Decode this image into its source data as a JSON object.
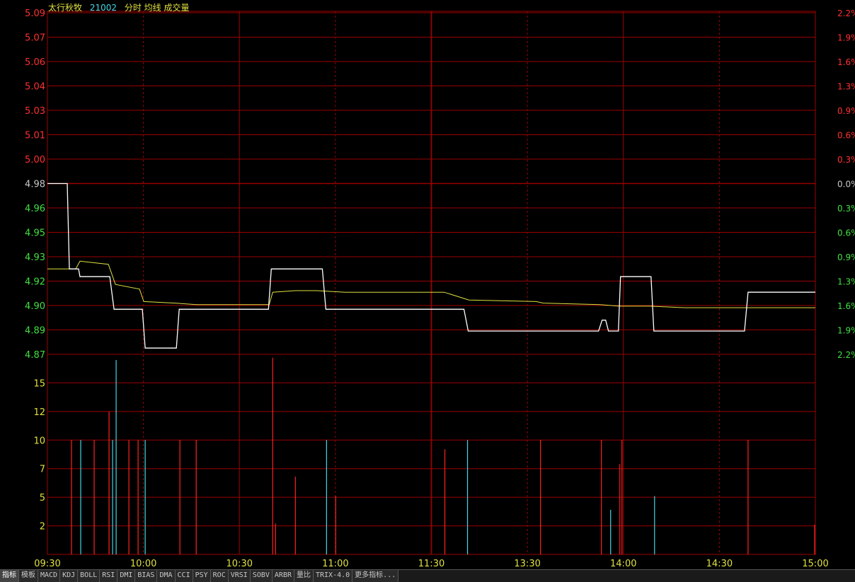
{
  "header": {
    "name": "太行秋牧",
    "code": "21002",
    "mode": "分时 均线 成交量"
  },
  "chart_data": {
    "type": "line",
    "x_ticks": [
      "09:30",
      "10:00",
      "10:30",
      "11:00",
      "11:30",
      "13:30",
      "14:00",
      "14:30",
      "15:00"
    ],
    "price_axis": {
      "ylim": [
        4.87,
        5.09
      ],
      "prev_close": 4.98,
      "ticks_up": [
        "5.09",
        "5.07",
        "5.06",
        "5.04",
        "5.03",
        "5.01",
        "5.00"
      ],
      "tick_mid": "4.98",
      "ticks_down": [
        "4.96",
        "4.95",
        "4.93",
        "4.92",
        "4.90",
        "4.89",
        "4.87"
      ],
      "pct_up": [
        "2.2%",
        "1.9%",
        "1.6%",
        "1.3%",
        "0.9%",
        "0.6%",
        "0.3%"
      ],
      "pct_mid": "0.0%",
      "pct_down": [
        "0.3%",
        "0.6%",
        "0.9%",
        "1.3%",
        "1.6%",
        "1.9%",
        "2.2%"
      ]
    },
    "volume_axis": {
      "ylim": [
        0,
        17.5
      ],
      "ticks": [
        "15",
        "12",
        "10",
        "7",
        "5",
        "2"
      ]
    },
    "price_series": [
      [
        0,
        4.98
      ],
      [
        28,
        4.98
      ],
      [
        31,
        4.925
      ],
      [
        44,
        4.925
      ],
      [
        46,
        4.92
      ],
      [
        88,
        4.92
      ],
      [
        94,
        4.899
      ],
      [
        134,
        4.899
      ],
      [
        138,
        4.874
      ],
      [
        182,
        4.874
      ],
      [
        186,
        4.899
      ],
      [
        312,
        4.899
      ],
      [
        316,
        4.925
      ],
      [
        388,
        4.925
      ],
      [
        393,
        4.899
      ],
      [
        588,
        4.899
      ],
      [
        594,
        4.885
      ],
      [
        778,
        4.885
      ],
      [
        783,
        4.892
      ],
      [
        788,
        4.892
      ],
      [
        792,
        4.885
      ],
      [
        806,
        4.885
      ],
      [
        809,
        4.92
      ],
      [
        852,
        4.92
      ],
      [
        856,
        4.885
      ],
      [
        984,
        4.885
      ],
      [
        989,
        4.91
      ],
      [
        1084,
        4.91
      ]
    ],
    "avg_series": [
      [
        0,
        4.925
      ],
      [
        40,
        4.925
      ],
      [
        46,
        4.93
      ],
      [
        86,
        4.928
      ],
      [
        96,
        4.915
      ],
      [
        130,
        4.912
      ],
      [
        136,
        4.904
      ],
      [
        180,
        4.903
      ],
      [
        210,
        4.902
      ],
      [
        313,
        4.902
      ],
      [
        318,
        4.91
      ],
      [
        350,
        4.911
      ],
      [
        380,
        4.911
      ],
      [
        420,
        4.91
      ],
      [
        560,
        4.91
      ],
      [
        595,
        4.905
      ],
      [
        690,
        4.904
      ],
      [
        700,
        4.903
      ],
      [
        780,
        4.902
      ],
      [
        806,
        4.901
      ],
      [
        850,
        4.901
      ],
      [
        900,
        4.9
      ],
      [
        1084,
        4.9
      ]
    ],
    "volume_bars": [
      {
        "x": 34,
        "v": 10,
        "c": "r"
      },
      {
        "x": 47,
        "v": 10,
        "c": "c"
      },
      {
        "x": 66,
        "v": 10,
        "c": "r"
      },
      {
        "x": 87,
        "v": 12.5,
        "c": "r"
      },
      {
        "x": 92,
        "v": 10,
        "c": "c"
      },
      {
        "x": 97,
        "v": 17,
        "c": "c"
      },
      {
        "x": 115,
        "v": 10,
        "c": "r"
      },
      {
        "x": 128,
        "v": 10,
        "c": "r"
      },
      {
        "x": 138,
        "v": 10,
        "c": "c"
      },
      {
        "x": 187,
        "v": 10,
        "c": "r"
      },
      {
        "x": 210,
        "v": 10,
        "c": "r"
      },
      {
        "x": 318,
        "v": 17.2,
        "c": "r"
      },
      {
        "x": 322,
        "v": 2.7,
        "c": "r"
      },
      {
        "x": 350,
        "v": 6.8,
        "c": "r"
      },
      {
        "x": 394,
        "v": 10,
        "c": "c"
      },
      {
        "x": 407,
        "v": 5.1,
        "c": "r"
      },
      {
        "x": 561,
        "v": 9.2,
        "c": "r"
      },
      {
        "x": 593,
        "v": 10,
        "c": "c"
      },
      {
        "x": 696,
        "v": 10,
        "c": "r"
      },
      {
        "x": 782,
        "v": 10,
        "c": "r"
      },
      {
        "x": 795,
        "v": 3.9,
        "c": "c"
      },
      {
        "x": 808,
        "v": 7.9,
        "c": "r"
      },
      {
        "x": 811,
        "v": 10,
        "c": "r"
      },
      {
        "x": 857,
        "v": 5.1,
        "c": "c"
      },
      {
        "x": 989,
        "v": 10,
        "c": "r"
      },
      {
        "x": 1083,
        "v": 2.6,
        "c": "r"
      }
    ],
    "colors": {
      "up": "#ff3030",
      "down": "#40e040",
      "flat": "#c8c8c8",
      "grid": "#9a0000",
      "price_line": "#ffffff",
      "avg_line": "#e0e040",
      "vol_up": "#ff2020",
      "vol_down": "#40d8e8",
      "vol_tick": "#e0e040",
      "time_label": "#e0e040"
    }
  },
  "indicator_tabs": [
    "指标",
    "模板",
    "MACD",
    "KDJ",
    "BOLL",
    "RSI",
    "DMI",
    "BIAS",
    "DMA",
    "CCI",
    "PSY",
    "ROC",
    "VRSI",
    "SOBV",
    "ARBR",
    "量比",
    "TRIX-4.0",
    "更多指标..."
  ]
}
